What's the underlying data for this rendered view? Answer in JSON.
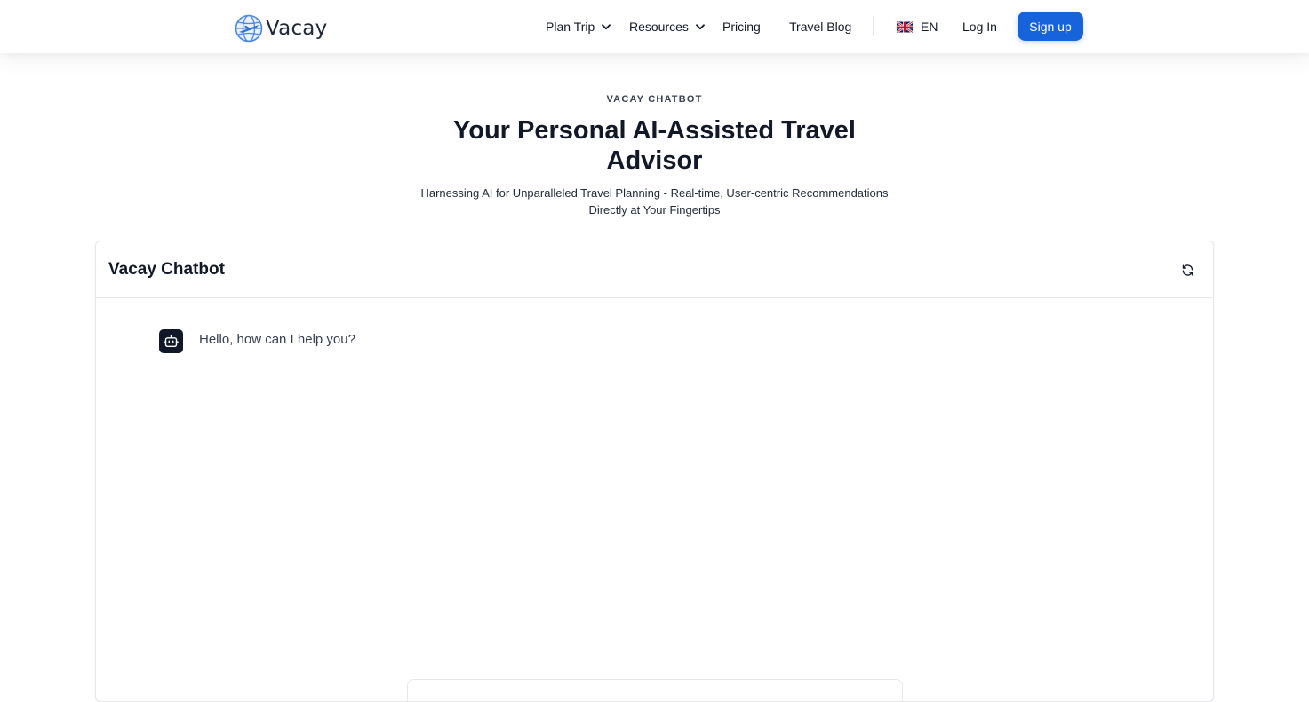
{
  "header": {
    "brand": "Vacay",
    "nav": {
      "plan_trip": "Plan Trip",
      "resources": "Resources",
      "pricing": "Pricing",
      "travel_blog": "Travel Blog"
    },
    "language": "EN",
    "login": "Log In",
    "signup": "Sign up"
  },
  "hero": {
    "eyebrow": "VACAY CHATBOT",
    "title": "Your Personal AI-Assisted Travel Advisor",
    "subtitle": "Harnessing AI for Unparalleled Travel Planning - Real-time, User-centric Recommendations Directly at Your Fingertips"
  },
  "chat": {
    "title": "Vacay Chatbot",
    "messages": [
      {
        "sender": "bot",
        "text": "Hello, how can I help you?"
      }
    ]
  },
  "icons": {
    "logo": "globe-plane-icon",
    "nav_dropdown": "chevron-down-icon",
    "language": "uk-flag-icon",
    "refresh": "refresh-icon",
    "bot": "robot-icon"
  },
  "colors": {
    "primary": "#1763dc",
    "logo": "#4a86e8",
    "text": "#111827",
    "border": "#e5e7eb",
    "avatar_bg": "#111827"
  }
}
